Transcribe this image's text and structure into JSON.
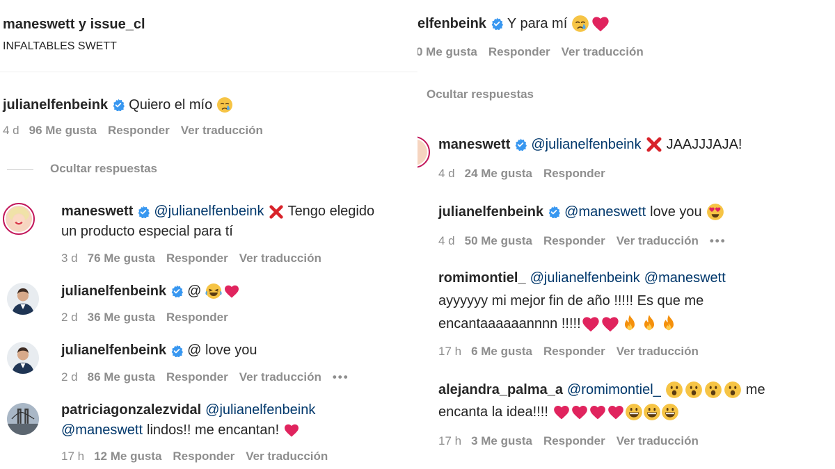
{
  "left": {
    "header": {
      "authors": "maneswett y issue_cl",
      "caption": "INFALTABLES SWETT"
    },
    "comment_main": {
      "username": "julianelfenbeink",
      "text": "Quiero el mío",
      "time": "4 d",
      "likes": "96 Me gusta",
      "reply": "Responder",
      "translate": "Ver traducción"
    },
    "hide_replies": "Ocultar respuestas",
    "replies": [
      {
        "username": "maneswett",
        "mention": "@julianelfenbeink",
        "text_line1": "Tengo elegido",
        "text_line2": "un producto especial para tí",
        "time": "3 d",
        "likes": "76 Me gusta",
        "reply": "Responder",
        "translate": "Ver traducción"
      },
      {
        "username": "julianelfenbeink",
        "text": "@",
        "time": "2 d",
        "likes": "36 Me gusta",
        "reply": "Responder"
      },
      {
        "username": "julianelfenbeink",
        "text": "@ love you",
        "time": "2 d",
        "likes": "86 Me gusta",
        "reply": "Responder",
        "translate": "Ver traducción",
        "more": "•••"
      },
      {
        "username": "patriciagonzalezvidal",
        "mention1": "@julianelfenbeink",
        "mention2": "@maneswett",
        "text": "lindos!! me encantan!",
        "time": "17 h",
        "likes": "12 Me gusta",
        "reply": "Responder",
        "translate": "Ver traducción"
      }
    ]
  },
  "right": {
    "top_comment": {
      "username": "elfenbeink",
      "text": "Y para mí",
      "likes": "0 Me gusta",
      "reply": "Responder",
      "translate": "Ver traducción"
    },
    "hide_replies": "Ocultar respuestas",
    "replies": [
      {
        "username": "maneswett",
        "mention": "@julianelfenbeink",
        "text": "JAAJJJAJA!",
        "time": "4 d",
        "likes": "24 Me gusta",
        "reply": "Responder"
      },
      {
        "username": "julianelfenbeink",
        "mention": "@maneswett",
        "text": "love you",
        "time": "4 d",
        "likes": "50 Me gusta",
        "reply": "Responder",
        "translate": "Ver traducción",
        "more": "•••"
      },
      {
        "username": "romimontiel_",
        "mention1": "@julianelfenbeink",
        "mention2": "@maneswett",
        "text_line1": "ayyyyyy mi mejor fin de año !!!!! Es que me",
        "text_line2": "encantaaaaaannnn !!!!!",
        "time": "17 h",
        "likes": "6 Me gusta",
        "reply": "Responder",
        "translate": "Ver traducción"
      },
      {
        "username": "alejandra_palma_a",
        "mention": "@romimontiel_",
        "text_after": "me",
        "text_line2": "encanta la idea!!!!",
        "time": "17 h",
        "likes": "3 Me gusta",
        "reply": "Responder",
        "translate": "Ver traducción"
      }
    ]
  },
  "colors": {
    "text": "#262626",
    "meta": "#8e8e8e",
    "mention": "#00376b",
    "verified": "#3897f0",
    "heart": "#e0245e",
    "cross": "#d8232a"
  }
}
